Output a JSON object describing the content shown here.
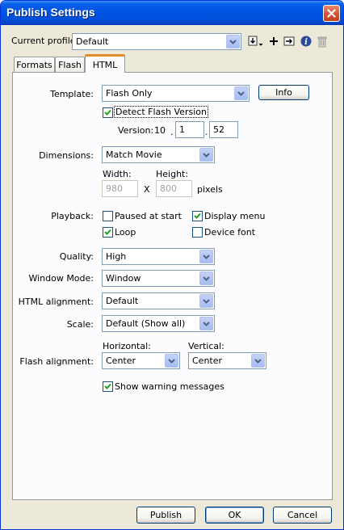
{
  "window": {
    "title": "Publish Settings"
  },
  "profile": {
    "label": "Current profile:",
    "value": "Default"
  },
  "tabs": [
    {
      "label": "Formats"
    },
    {
      "label": "Flash"
    },
    {
      "label": "HTML"
    }
  ],
  "template": {
    "label": "Template:",
    "value": "Flash Only",
    "info_button": "Info"
  },
  "detect_flash": {
    "label": "Detect Flash Version",
    "checked": true
  },
  "version": {
    "label": "Version:",
    "major": "10",
    "minor": "1",
    "revision": "52",
    "sep": "."
  },
  "dimensions": {
    "label": "Dimensions:",
    "value": "Match Movie",
    "width_label": "Width:",
    "height_label": "Height:",
    "width": "980",
    "height": "800",
    "x_sep": "X",
    "unit": "pixels"
  },
  "playback": {
    "label": "Playback:",
    "paused": {
      "label": "Paused at start",
      "checked": false
    },
    "display_menu": {
      "label": "Display menu",
      "checked": true
    },
    "loop": {
      "label": "Loop",
      "checked": true
    },
    "device_font": {
      "label": "Device font",
      "checked": false
    }
  },
  "quality": {
    "label": "Quality:",
    "value": "High"
  },
  "window_mode": {
    "label": "Window Mode:",
    "value": "Window"
  },
  "html_alignment": {
    "label": "HTML alignment:",
    "value": "Default"
  },
  "scale": {
    "label": "Scale:",
    "value": "Default (Show all)"
  },
  "flash_alignment": {
    "label": "Flash alignment:",
    "horizontal_label": "Horizontal:",
    "horizontal_value": "Center",
    "vertical_label": "Vertical:",
    "vertical_value": "Center"
  },
  "show_warnings": {
    "label": "Show warning messages",
    "checked": true
  },
  "buttons": {
    "publish": "Publish",
    "ok": "OK",
    "cancel": "Cancel"
  },
  "colors": {
    "titlebar": "#0054e3",
    "dialog_bg": "#ece9d8",
    "tab_accent": "#e68b2c",
    "check": "#21a121"
  }
}
